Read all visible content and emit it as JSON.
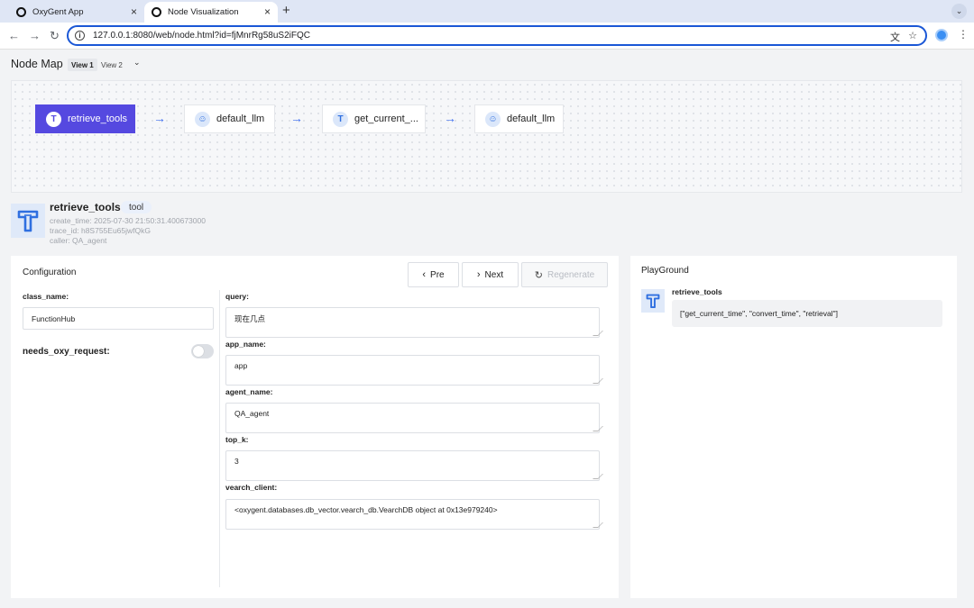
{
  "browser": {
    "tabs": [
      {
        "title": "OxyGent App",
        "active": false
      },
      {
        "title": "Node Visualization",
        "active": true
      }
    ],
    "url": "127.0.0.1:8080/web/node.html?id=fjMnrRg58uS2iFQC",
    "accent": "#1a57d6"
  },
  "header": {
    "title": "Node Map",
    "views": [
      "View 1",
      "View 2"
    ],
    "active_view": "View 1"
  },
  "node_map": {
    "nodes": [
      {
        "label": "retrieve_tools",
        "icon": "tool-icon",
        "active": true
      },
      {
        "label": "default_llm",
        "icon": "llm-icon",
        "active": false
      },
      {
        "label": "get_current_...",
        "icon": "tool-icon",
        "active": false
      },
      {
        "label": "default_llm",
        "icon": "llm-icon",
        "active": false
      }
    ],
    "active_color": "#5549e0",
    "arrow_color": "#3e6ff0"
  },
  "node_detail": {
    "name": "retrieve_tools",
    "tag": "tool",
    "create_time": "create_time: 2025-07-30 21:50:31.400673000",
    "trace_id": "trace_id: h8S755Eu65jwfQkG",
    "caller": "caller: QA_agent"
  },
  "configuration": {
    "title": "Configuration",
    "buttons": {
      "pre": "Pre",
      "next": "Next",
      "regenerate": "Regenerate"
    },
    "class_name_label": "class_name:",
    "class_name_value": "FunctionHub",
    "needs_oxy_request_label": "needs_oxy_request:",
    "needs_oxy_request_value": false,
    "params": [
      {
        "label": "query:",
        "value": "现在几点"
      },
      {
        "label": "app_name:",
        "value": "app"
      },
      {
        "label": "agent_name:",
        "value": "QA_agent"
      },
      {
        "label": "top_k:",
        "value": "3"
      },
      {
        "label": "vearch_client:",
        "value": "<oxygent.databases.db_vector.vearch_db.VearchDB object at 0x13e979240>"
      }
    ]
  },
  "playground": {
    "title": "PlayGround",
    "message_name": "retrieve_tools",
    "message_text": "[\"get_current_time\", \"convert_time\", \"retrieval\"]"
  }
}
